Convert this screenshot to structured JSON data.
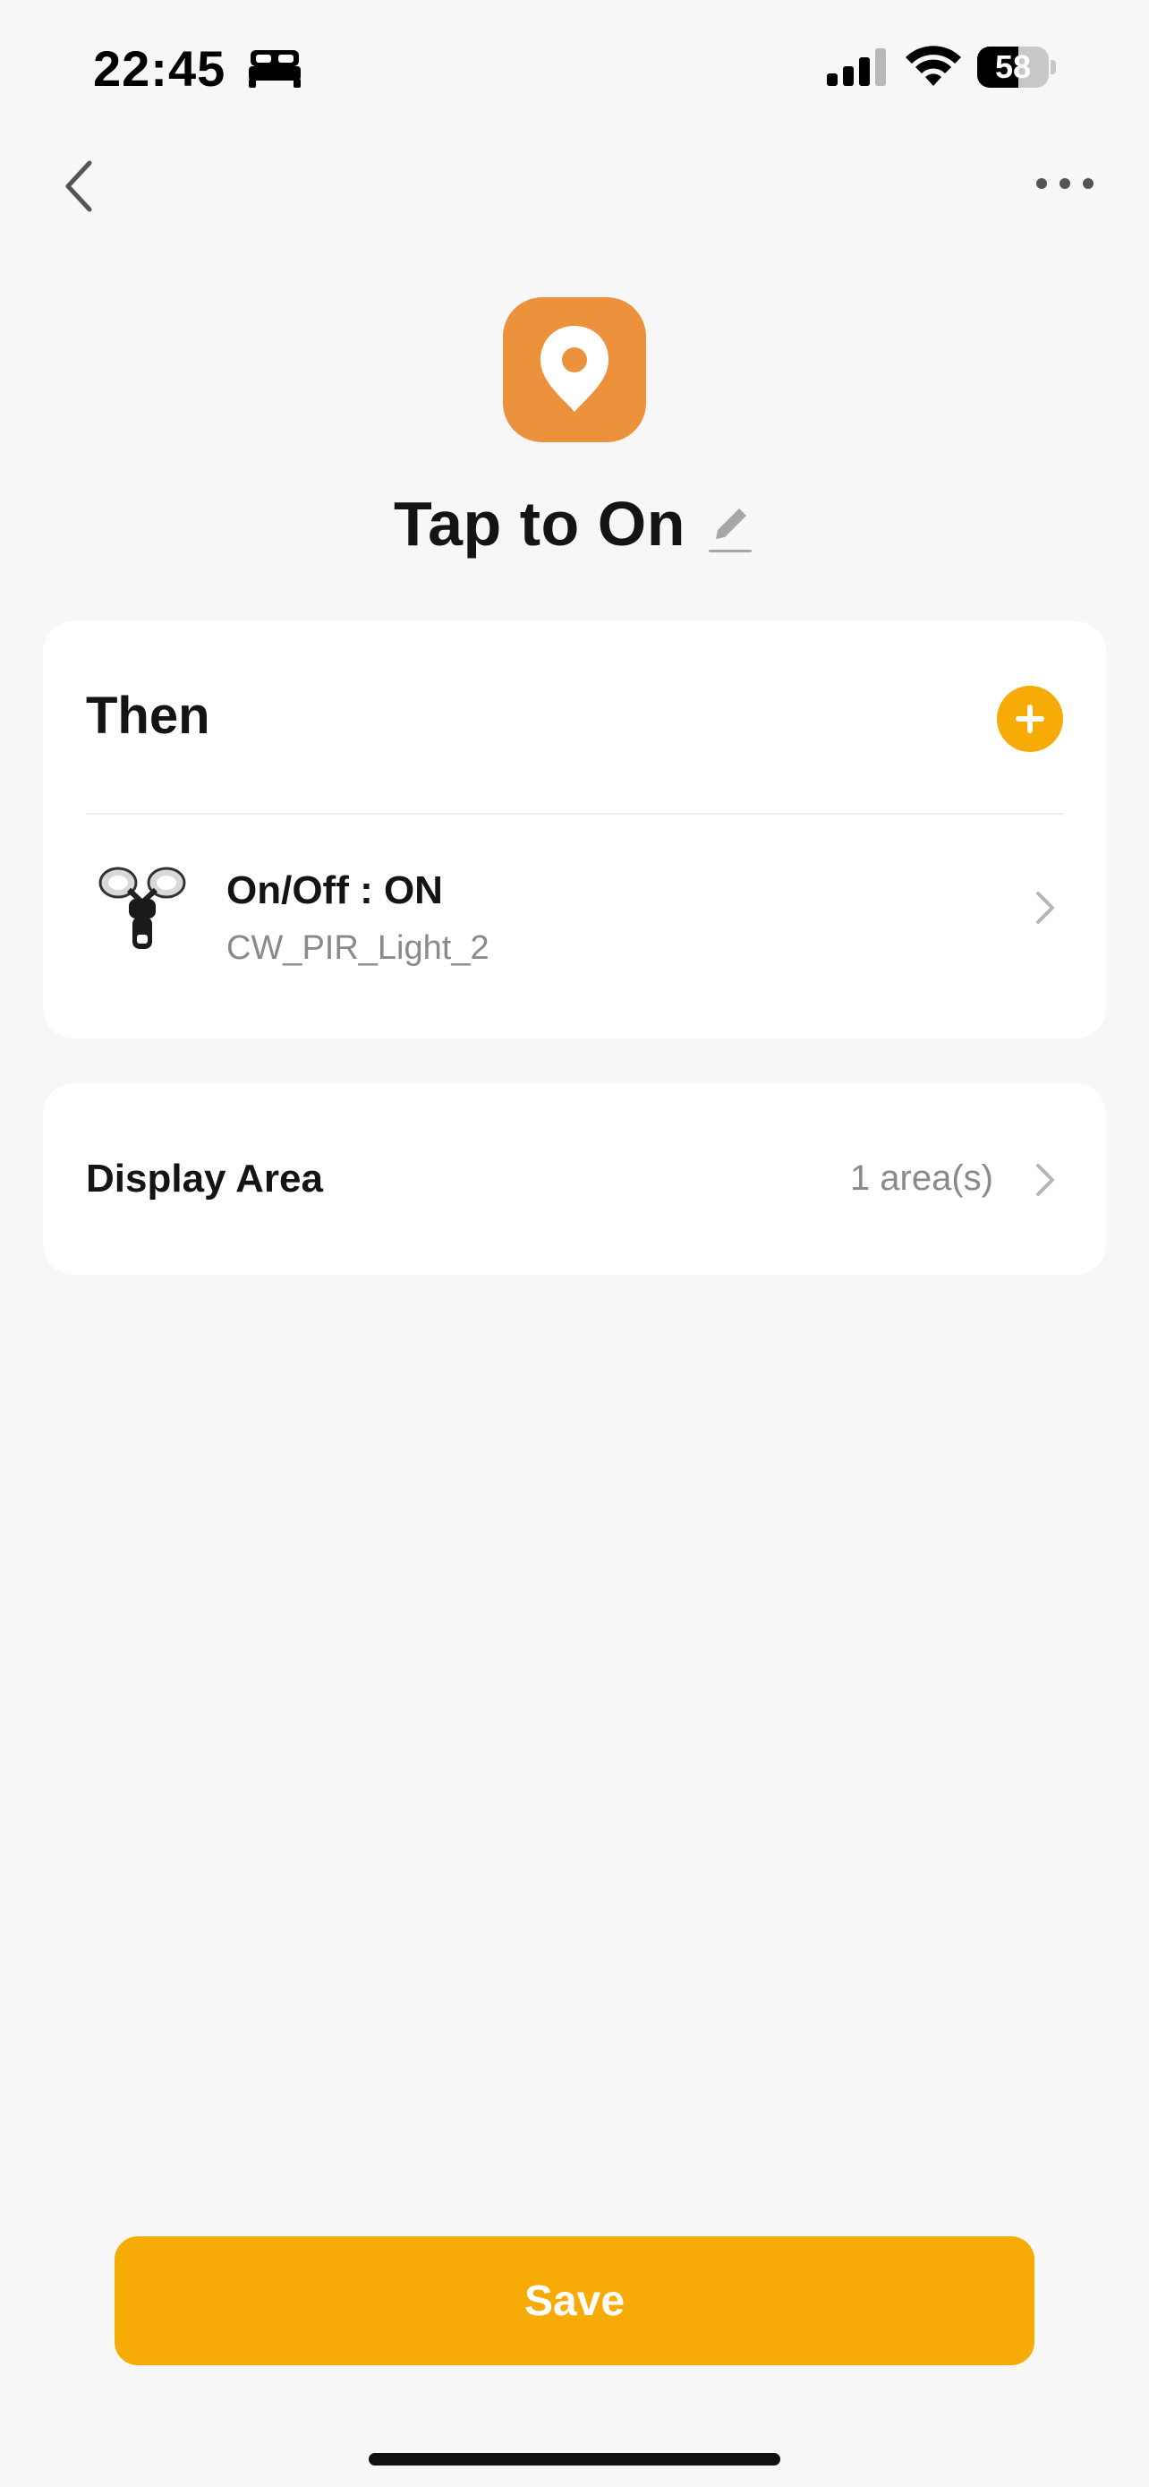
{
  "status_bar": {
    "time": "22:45",
    "battery_level": "58",
    "battery_fraction": 0.58,
    "icons": [
      "bed-icon",
      "signal-icon",
      "wifi-icon",
      "battery-icon"
    ]
  },
  "nav": {
    "back_icon": "chevron-left-icon",
    "more_icon": "more-horizontal-icon"
  },
  "scene": {
    "icon": "location-pin-icon",
    "icon_color": "#ec913c",
    "title": "Tap to On",
    "edit_icon": "pencil-icon"
  },
  "then_section": {
    "heading": "Then",
    "add_icon": "plus-icon",
    "accent_color": "#f6ab07",
    "actions": [
      {
        "title": "On/Off : ON",
        "device": "CW_PIR_Light_2",
        "image": "floodlight-device-icon"
      }
    ]
  },
  "display_area": {
    "label": "Display Area",
    "value": "1 area(s)"
  },
  "footer": {
    "save_label": "Save"
  }
}
